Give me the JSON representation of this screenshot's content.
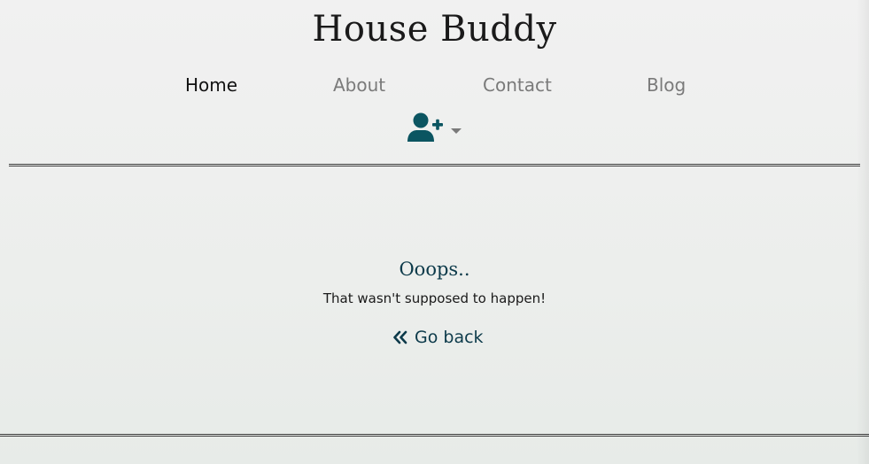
{
  "header": {
    "site_title": "House Buddy",
    "nav": {
      "items": [
        {
          "label": "Home",
          "active": true
        },
        {
          "label": "About",
          "active": false
        },
        {
          "label": "Contact",
          "active": false
        },
        {
          "label": "Blog",
          "active": false
        }
      ]
    },
    "user_menu": {
      "icon": "user-plus-icon",
      "dropdown_icon": "caret-down-icon"
    }
  },
  "main": {
    "error_title": "Ooops..",
    "error_message": "That wasn't supposed to happen!",
    "go_back": {
      "label": "Go back",
      "icon": "double-chevron-left-icon"
    }
  },
  "colors": {
    "accent": "#0c3a4a",
    "icon_teal": "#0b5561",
    "nav_inactive": "#7a7a7a",
    "nav_active": "#111111",
    "text": "#1a1a1a"
  }
}
